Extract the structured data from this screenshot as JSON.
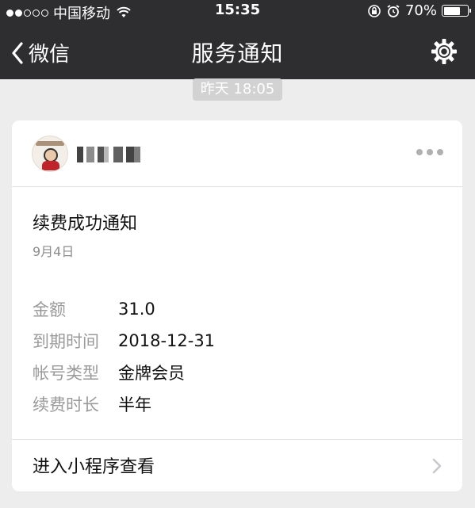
{
  "status_bar": {
    "carrier": "中国移动",
    "time": "15:35",
    "battery": "70%",
    "battery_level": 0.7,
    "signal_bars": 2
  },
  "nav": {
    "back_label": "微信",
    "title": "服务通知"
  },
  "chat": {
    "timestamp": "昨天 18:05"
  },
  "card": {
    "title": "续费成功通知",
    "date": "9月4日",
    "fields": [
      {
        "label": "金额",
        "value": "31.0"
      },
      {
        "label": "到期时间",
        "value": "2018-12-31"
      },
      {
        "label": "帐号类型",
        "value": "金牌会员"
      },
      {
        "label": "续费时长",
        "value": "半年"
      }
    ],
    "footer_label": "进入小程序查看"
  },
  "colors": {
    "nav_background": "#2e2e30",
    "page_background": "#ededed",
    "card_background": "#ffffff",
    "muted_text": "#9a9a9a"
  },
  "icons": [
    "wifi-icon",
    "lock-rotation-icon",
    "alarm-icon",
    "battery-icon",
    "back-chevron-icon",
    "gear-icon",
    "more-icon",
    "chevron-right-icon"
  ]
}
